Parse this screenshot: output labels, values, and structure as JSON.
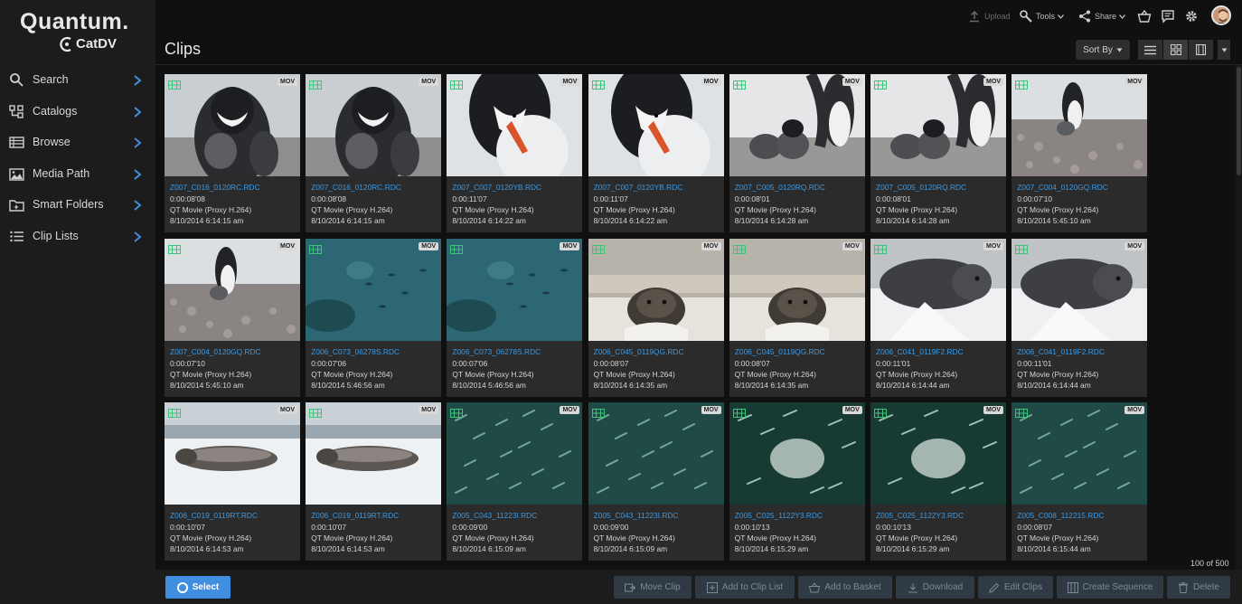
{
  "brand": {
    "company": "Quantum.",
    "product": "CatDV"
  },
  "nav": [
    {
      "label": "Search",
      "icon": "search-icon"
    },
    {
      "label": "Catalogs",
      "icon": "catalogs-icon"
    },
    {
      "label": "Browse",
      "icon": "browse-icon"
    },
    {
      "label": "Media Path",
      "icon": "image-icon"
    },
    {
      "label": "Smart Folders",
      "icon": "smart-folder-icon"
    },
    {
      "label": "Clip Lists",
      "icon": "list-icon"
    }
  ],
  "topbar": {
    "upload": "Upload",
    "tools": "Tools",
    "share": "Share"
  },
  "page_title": "Clips",
  "sort_by": "Sort By",
  "format_badge": "MOV",
  "clips": [
    {
      "name": "Z007_C016_0120RC.RDC",
      "duration": "0:00:08'08",
      "type": "QT Movie (Proxy H.264)",
      "date": "8/10/2014 6:14:15 am",
      "scene": "penguin-chick"
    },
    {
      "name": "Z007_C016_0120RC.RDC",
      "duration": "0:00:08'08",
      "type": "QT Movie (Proxy H.264)",
      "date": "8/10/2014 6:14:15 am",
      "scene": "penguin-chick"
    },
    {
      "name": "Z007_C007_0120YB.RDC",
      "duration": "0:00:11'07",
      "type": "QT Movie (Proxy H.264)",
      "date": "8/10/2014 6:14:22 am",
      "scene": "penguin-closeup"
    },
    {
      "name": "Z007_C007_0120YB.RDC",
      "duration": "0:00:11'07",
      "type": "QT Movie (Proxy H.264)",
      "date": "8/10/2014 6:14:22 am",
      "scene": "penguin-closeup"
    },
    {
      "name": "Z007_C005_0120RQ.RDC",
      "duration": "0:00:08'01",
      "type": "QT Movie (Proxy H.264)",
      "date": "8/10/2014 6:14:28 am",
      "scene": "penguin-group"
    },
    {
      "name": "Z007_C005_0120RQ.RDC",
      "duration": "0:00:08'01",
      "type": "QT Movie (Proxy H.264)",
      "date": "8/10/2014 6:14:28 am",
      "scene": "penguin-group"
    },
    {
      "name": "Z007_C004_0120GQ.RDC",
      "duration": "0:00:07'10",
      "type": "QT Movie (Proxy H.264)",
      "date": "8/10/2014 5:45:10 am",
      "scene": "penguin-nest"
    },
    {
      "name": "Z007_C004_0120GQ.RDC",
      "duration": "0:00:07'10",
      "type": "QT Movie (Proxy H.264)",
      "date": "8/10/2014 5:45:10 am",
      "scene": "penguin-nest"
    },
    {
      "name": "Z006_C073_06278S.RDC",
      "duration": "0:00:07'06",
      "type": "QT Movie (Proxy H.264)",
      "date": "8/10/2014 5:46:56 am",
      "scene": "underwater"
    },
    {
      "name": "Z006_C073_06278S.RDC",
      "duration": "0:00:07'06",
      "type": "QT Movie (Proxy H.264)",
      "date": "8/10/2014 5:46:56 am",
      "scene": "underwater"
    },
    {
      "name": "Z006_C045_0119QG.RDC",
      "duration": "0:00:08'07",
      "type": "QT Movie (Proxy H.264)",
      "date": "8/10/2014 6:14:35 am",
      "scene": "seal-pup"
    },
    {
      "name": "Z006_C045_0119QG.RDC",
      "duration": "0:00:08'07",
      "type": "QT Movie (Proxy H.264)",
      "date": "8/10/2014 6:14:35 am",
      "scene": "seal-pup"
    },
    {
      "name": "Z006_C041_0119F2.RDC",
      "duration": "0:00:11'01",
      "type": "QT Movie (Proxy H.264)",
      "date": "8/10/2014 6:14:44 am",
      "scene": "seal-snow"
    },
    {
      "name": "Z006_C041_0119F2.RDC",
      "duration": "0:00:11'01",
      "type": "QT Movie (Proxy H.264)",
      "date": "8/10/2014 6:14:44 am",
      "scene": "seal-snow"
    },
    {
      "name": "Z006_C019_0119RT.RDC",
      "duration": "0:00:10'07",
      "type": "QT Movie (Proxy H.264)",
      "date": "8/10/2014 6:14:53 am",
      "scene": "seal-lying"
    },
    {
      "name": "Z006_C019_0119RT.RDC",
      "duration": "0:00:10'07",
      "type": "QT Movie (Proxy H.264)",
      "date": "8/10/2014 6:14:53 am",
      "scene": "seal-lying"
    },
    {
      "name": "Z005_C043_11223I.RDC",
      "duration": "0:00:09'00",
      "type": "QT Movie (Proxy H.264)",
      "date": "8/10/2014 6:15:09 am",
      "scene": "fish-school"
    },
    {
      "name": "Z005_C043_11223I.RDC",
      "duration": "0:00:09'00",
      "type": "QT Movie (Proxy H.264)",
      "date": "8/10/2014 6:15:09 am",
      "scene": "fish-school"
    },
    {
      "name": "Z005_C025_1122Y3.RDC",
      "duration": "0:00:10'13",
      "type": "QT Movie (Proxy H.264)",
      "date": "8/10/2014 6:15:29 am",
      "scene": "fish-swirl"
    },
    {
      "name": "Z005_C025_1122Y3.RDC",
      "duration": "0:00:10'13",
      "type": "QT Movie (Proxy H.264)",
      "date": "8/10/2014 6:15:29 am",
      "scene": "fish-swirl"
    },
    {
      "name": "Z005_C008_112215.RDC",
      "duration": "0:00:08'07",
      "type": "QT Movie (Proxy H.264)",
      "date": "8/10/2014 6:15:44 am",
      "scene": "fish-school"
    }
  ],
  "count_label": "100 of 500",
  "bottom": {
    "select": "Select",
    "actions": [
      {
        "label": "Move Clip",
        "icon": "move-icon"
      },
      {
        "label": "Add to Clip List",
        "icon": "add-list-icon"
      },
      {
        "label": "Add to Basket",
        "icon": "basket-icon"
      },
      {
        "label": "Download",
        "icon": "download-icon"
      },
      {
        "label": "Edit Clips",
        "icon": "edit-icon"
      },
      {
        "label": "Create Sequence",
        "icon": "sequence-icon"
      },
      {
        "label": "Delete",
        "icon": "delete-icon"
      }
    ]
  },
  "colors": {
    "accent": "#3f8ee0",
    "link": "#3a9ae6",
    "film": "#3ec47a"
  }
}
